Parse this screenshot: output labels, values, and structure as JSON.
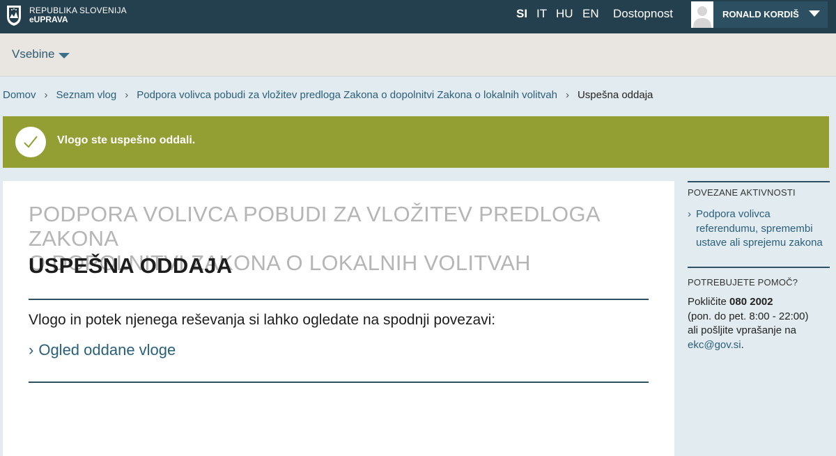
{
  "header": {
    "brand_line1": "REPUBLIKA SLOVENIJA",
    "brand_line2": "eUPRAVA",
    "languages": [
      {
        "code": "SI",
        "active": true
      },
      {
        "code": "IT",
        "active": false
      },
      {
        "code": "HU",
        "active": false
      },
      {
        "code": "EN",
        "active": false
      }
    ],
    "accessibility_label": "Dostopnost",
    "user_name": "RONALD KORDIŠ"
  },
  "menu": {
    "label": "Vsebine"
  },
  "breadcrumb": {
    "items": [
      "Domov",
      "Seznam vlog",
      "Podpora volivca pobudi za vložitev predloga Zakona o dopolnitvi Zakona o lokalnih volitvah"
    ],
    "current": "Uspešna oddaja",
    "separator": "›"
  },
  "banner": {
    "message": "Vlogo ste uspešno oddali."
  },
  "main": {
    "title_line1": "PODPORA VOLIVCA POBUDI ZA VLOŽITEV PREDLOGA ZAKONA",
    "title_line2": "O DOPOLNITVI ZAKONA O LOKALNIH VOLITVAH",
    "subtitle": "USPEŠNA ODDAJA",
    "info_text": "Vlogo in potek njenega reševanja si lahko ogledate na spodnji povezavi:",
    "link_chevron": "›",
    "link_text": "Ogled oddane vloge"
  },
  "sidebar": {
    "related_heading": "POVEZANE AKTIVNOSTI",
    "related_link_chevron": "›",
    "related_link_line1": "Podpora volivca",
    "related_link_line2": "referendumu, spremembi",
    "related_link_line3": "ustave ali sprejemu zakona",
    "help_heading": "POTREBUJETE POMOČ?",
    "help_call_prefix": "Pokličite",
    "help_phone": "080 2002",
    "help_hours": "(pon. do pet. 8:00 - 22:00)",
    "help_or_send": "ali pošljite vprašanje na",
    "help_email": "ekc@gov.si",
    "help_email_suffix": "."
  },
  "colors": {
    "topbar": "#24404f",
    "banner": "#939e33",
    "link": "#2a5f7a",
    "rule": "#2d4f62"
  }
}
